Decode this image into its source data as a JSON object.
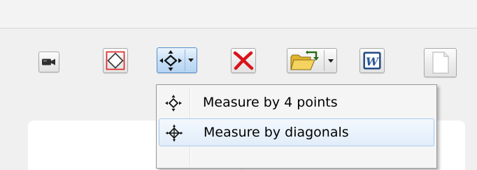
{
  "toolbar": {
    "buttons": [
      {
        "name": "camera",
        "icon": "video-camera-icon"
      },
      {
        "name": "shape",
        "icon": "diamond-frame-icon"
      },
      {
        "name": "measure",
        "icon": "four-point-arrows-icon",
        "active": true,
        "dropdown": true
      },
      {
        "name": "delete",
        "icon": "red-x-icon"
      },
      {
        "name": "open",
        "icon": "open-folder-icon",
        "dropdown": true
      },
      {
        "name": "word",
        "icon": "word-document-icon"
      },
      {
        "name": "blank",
        "icon": "blank-page-icon"
      }
    ]
  },
  "measure_menu": {
    "items": [
      {
        "label": "Measure by 4 points",
        "icon": "four-point-arrows-icon",
        "highlighted": false
      },
      {
        "label": "Measure by diagonals",
        "icon": "crosshair-diagonal-icon",
        "highlighted": true
      }
    ]
  },
  "colors": {
    "active_button": "#c8e0f7",
    "menu_highlight": "#e1edfa",
    "delete_red": "#d8141b",
    "word_blue": "#2b5797"
  }
}
